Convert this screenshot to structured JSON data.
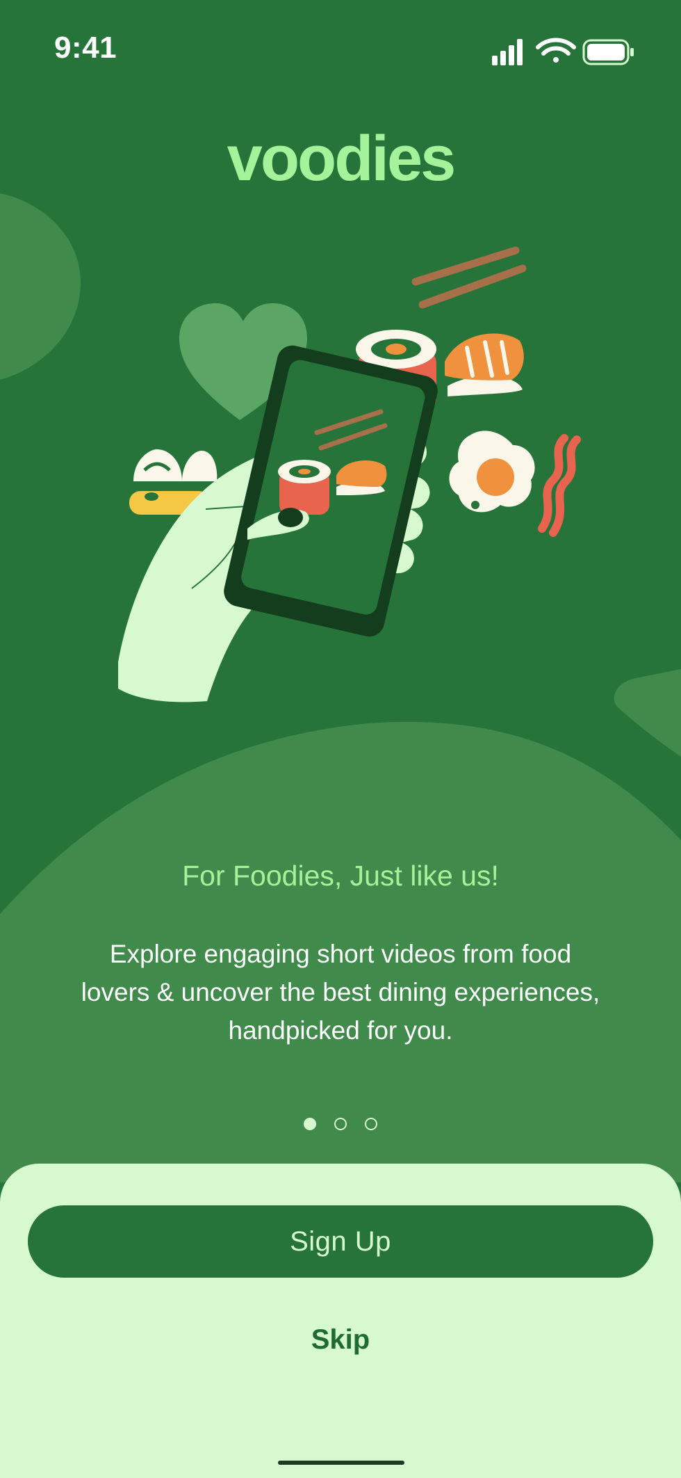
{
  "status_bar": {
    "time": "9:41"
  },
  "logo": {
    "text": "voodies"
  },
  "onboarding": {
    "headline": "For Foodies, Just like us!",
    "body": "Explore engaging short videos from food lovers & uncover the best dining experiences, handpicked for you.",
    "pager": {
      "total": 3,
      "current": 1
    }
  },
  "actions": {
    "signup_label": "Sign Up",
    "skip_label": "Skip"
  },
  "colors": {
    "background": "#26743A",
    "blob": "#408A4C",
    "accent_green": "#A4F39A",
    "sheet": "#D6F9D0",
    "button": "#26743A"
  },
  "icons": [
    "signal-icon",
    "wifi-icon",
    "battery-icon",
    "heart-icon",
    "phone-icon",
    "sushi-icon",
    "egg-icon",
    "bacon-icon",
    "dumpling-icon",
    "chopsticks-icon",
    "hand-icon"
  ]
}
